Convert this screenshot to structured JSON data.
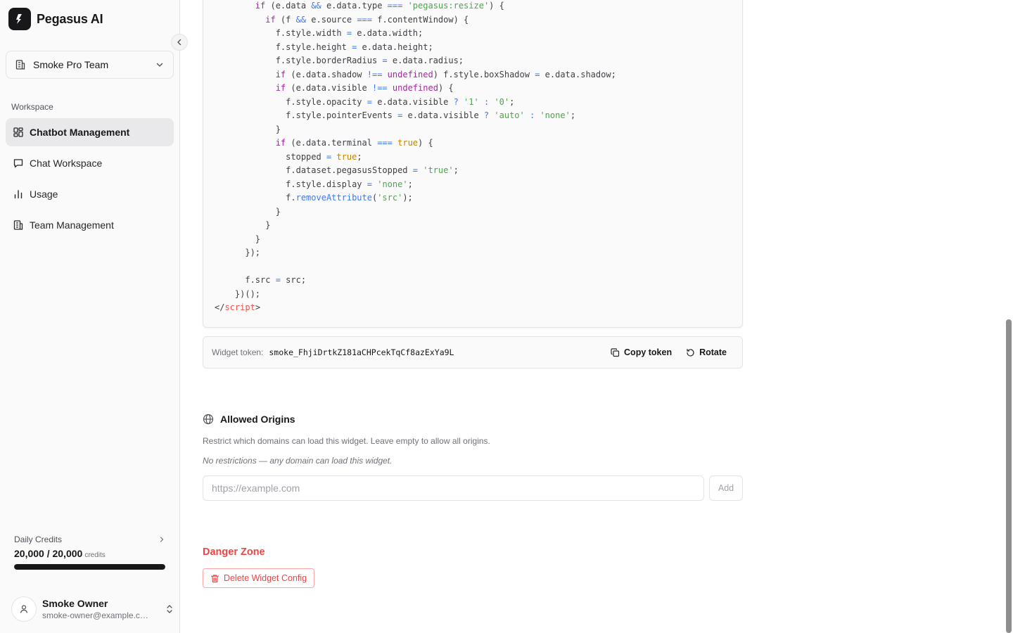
{
  "app": {
    "name": "Pegasus AI"
  },
  "team_selector": {
    "selected": "Smoke Pro Team"
  },
  "sidebar": {
    "section_label": "Workspace",
    "items": [
      {
        "label": "Chatbot Management",
        "icon": "dashboard-grid-icon",
        "active": true
      },
      {
        "label": "Chat Workspace",
        "icon": "chat-bubble-icon",
        "active": false
      },
      {
        "label": "Usage",
        "icon": "bar-chart-icon",
        "active": false
      },
      {
        "label": "Team Management",
        "icon": "building-icon",
        "active": false
      }
    ]
  },
  "credits": {
    "label": "Daily Credits",
    "value": "20,000 / 20,000",
    "unit": "credits",
    "used_fraction": 1.0
  },
  "user": {
    "name": "Smoke Owner",
    "email": "smoke-owner@example.com"
  },
  "token": {
    "label": "Widget token:",
    "value": "smoke_FhjiDrtkZ181aCHPcekTqCf8azExYa9L",
    "copy_label": "Copy token",
    "rotate_label": "Rotate"
  },
  "origins": {
    "title": "Allowed Origins",
    "description": "Restrict which domains can load this widget. Leave empty to allow all origins.",
    "empty_text": "No restrictions — any domain can load this widget.",
    "input_value": "",
    "input_placeholder": "https://example.com",
    "add_label": "Add"
  },
  "danger": {
    "title": "Danger Zone",
    "delete_label": "Delete Widget Config"
  },
  "colors": {
    "accent": "#18181b",
    "danger": "#ef4444",
    "sidebar_bg": "#fafafa"
  }
}
